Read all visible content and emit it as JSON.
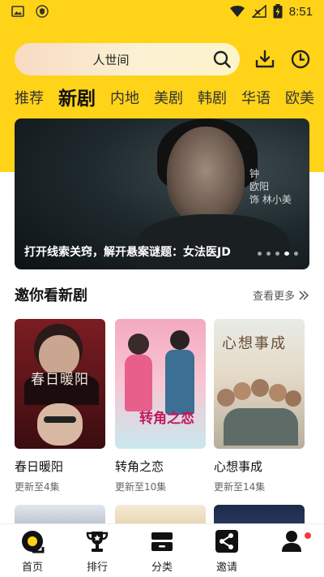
{
  "status_bar": {
    "time": "8:51",
    "icons": [
      "image-icon",
      "shield-icon",
      "wifi-icon",
      "signal-icon",
      "battery-icon"
    ]
  },
  "search": {
    "value": "人世间",
    "icons": [
      "search-icon",
      "download-icon",
      "history-icon"
    ]
  },
  "tabs": [
    {
      "label": "推荐"
    },
    {
      "label": "新剧",
      "active": true
    },
    {
      "label": "内地"
    },
    {
      "label": "美剧"
    },
    {
      "label": "韩剧"
    },
    {
      "label": "华语"
    },
    {
      "label": "欧美"
    }
  ],
  "banner": {
    "caption": "打开线索关窍，解开悬案谜题：女法医JD",
    "side_text_1": "钟",
    "side_text_2": "欧阳",
    "side_text_3": "饰 林小美",
    "dots": 5,
    "active_dot": 4
  },
  "section": {
    "title": "邀你看新剧",
    "see_more": "查看更多"
  },
  "cards": [
    {
      "title": "春日暖阳",
      "update": "更新至4集",
      "poster_text": "春日暖阳"
    },
    {
      "title": "转角之恋",
      "update": "更新至10集",
      "poster_text": "转角之恋"
    },
    {
      "title": "心想事成",
      "update": "更新至14集",
      "poster_text": "心想事成"
    }
  ],
  "bottom_nav": [
    {
      "label": "首页",
      "icon": "home-icon",
      "active": true
    },
    {
      "label": "排行",
      "icon": "trophy-icon"
    },
    {
      "label": "分类",
      "icon": "category-icon"
    },
    {
      "label": "邀请",
      "icon": "share-icon"
    },
    {
      "label": "",
      "icon": "profile-icon",
      "badge": true
    }
  ],
  "colors": {
    "accent": "#FFD318",
    "badge": "#F03C3C"
  }
}
